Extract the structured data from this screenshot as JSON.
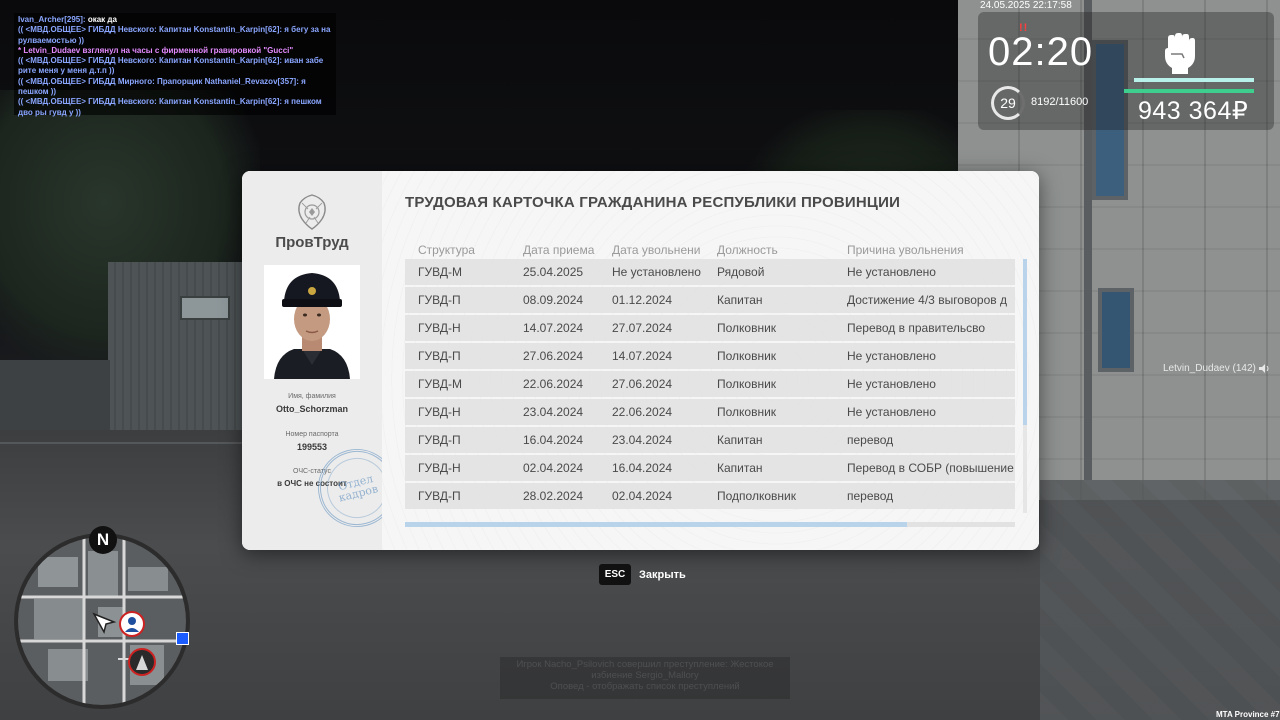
{
  "chat": [
    {
      "color": "white",
      "parts": [
        {
          "c": "blue",
          "t": "Ivan_Archer[295]:"
        },
        {
          "c": "white",
          "t": " окак да"
        }
      ]
    },
    {
      "color": "blue",
      "parts": [
        {
          "c": "blue",
          "t": "(( <МВД.ОБЩЕЕ> ГИБДД Невского: Капитан Konstantin_Karpin[62]: я бегу за на рулваемостью ))"
        }
      ]
    },
    {
      "color": "pink",
      "parts": [
        {
          "c": "pink",
          "t": "* Letvin_Dudaev взглянул на часы с фирменной гравировкой \"Gucci\""
        }
      ]
    },
    {
      "color": "blue",
      "parts": [
        {
          "c": "blue",
          "t": "(( <МВД.ОБЩЕЕ> ГИБДД Невского: Капитан Konstantin_Karpin[62]: иван забе рите меня у меня д.т.п ))"
        }
      ]
    },
    {
      "color": "blue",
      "parts": [
        {
          "c": "blue",
          "t": "(( <МВД.ОБЩЕЕ> ГИБДД Мирного: Прапорщик Nathaniel_Revazov[357]: я пешком ))"
        }
      ]
    },
    {
      "color": "blue",
      "parts": [
        {
          "c": "blue",
          "t": "(( <МВД.ОБЩЕЕ> ГИБДД Невского: Капитан Konstantin_Karpin[62]: я пешком дво ры гувд у ))"
        }
      ]
    }
  ],
  "hud": {
    "datetime": "24.05.2025 22:17:58",
    "wanted_marks": "!!",
    "clock": "02:20",
    "level": "29",
    "xp": "8192/11600",
    "money": "943 364₽",
    "fist_icon": "fist-icon",
    "bar_colors": [
      "#b8f0ea",
      "#3ecf8e"
    ]
  },
  "player_tag": "Letvin_Dudaev (142)",
  "card": {
    "brand": "ПровТруд",
    "title": "ТРУДОВАЯ КАРТОЧКА ГРАЖДАНИНА РЕСПУБЛИКИ ПРОВИНЦИИ",
    "name_label": "Имя, фамилия",
    "name_value": "Otto_Schorzman",
    "passport_label": "Номер паспорта",
    "passport_value": "199553",
    "ochs_label": "ОЧС-статус",
    "ochs_value": "в ОЧС не состоит",
    "stamp_line1": "Отдел",
    "stamp_line2": "кадров",
    "columns": [
      "Структура",
      "Дата приема",
      "Дата увольнени",
      "Должность",
      "Причина увольнения"
    ],
    "rows": [
      [
        "ГУВД-М",
        "25.04.2025",
        "Не установлено",
        "Рядовой",
        "Не установлено"
      ],
      [
        "ГУВД-П",
        "08.09.2024",
        "01.12.2024",
        "Капитан",
        "Достижение 4/3 выговоров д"
      ],
      [
        "ГУВД-Н",
        "14.07.2024",
        "27.07.2024",
        "Полковник",
        "Перевод в правительсво"
      ],
      [
        "ГУВД-П",
        "27.06.2024",
        "14.07.2024",
        "Полковник",
        "Не установлено"
      ],
      [
        "ГУВД-М",
        "22.06.2024",
        "27.06.2024",
        "Полковник",
        "Не установлено"
      ],
      [
        "ГУВД-Н",
        "23.04.2024",
        "22.06.2024",
        "Полковник",
        "Не установлено"
      ],
      [
        "ГУВД-П",
        "16.04.2024",
        "23.04.2024",
        "Капитан",
        "перевод"
      ],
      [
        "ГУВД-Н",
        "02.04.2024",
        "16.04.2024",
        "Капитан",
        "Перевод в СОБР (повышение"
      ],
      [
        "ГУВД-П",
        "28.02.2024",
        "02.04.2024",
        "Подполковник",
        "перевод"
      ]
    ]
  },
  "close": {
    "key": "ESC",
    "label": "Закрыть"
  },
  "minimap": {
    "north": "N"
  },
  "notice": [
    "Игрок Nacho_Psilovich совершил преступление: Жестокое",
    "избиение Sergio_Mallory",
    "Оповед - отображать список преступлений"
  ],
  "server": "MTA Province #7"
}
